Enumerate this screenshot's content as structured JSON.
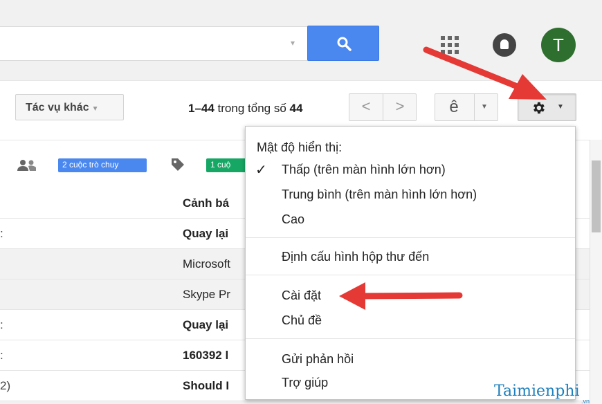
{
  "header": {
    "search_placeholder": "",
    "avatar_letter": "T"
  },
  "toolbar": {
    "more_actions_label": "Tác vụ khác",
    "range_bold_1": "1–44",
    "range_middle": " trong tổng số ",
    "range_bold_2": "44",
    "prev_label": "<",
    "next_label": ">",
    "language_label": "ê"
  },
  "tabs": {
    "social_badge": "2 cuộc trò chuy",
    "promo_badge": "1 cuộ"
  },
  "rows": [
    {
      "left": "",
      "subject": "Cảnh bá",
      "unread": true
    },
    {
      "left": ":",
      "subject": "Quay lại",
      "unread": true
    },
    {
      "left": "",
      "subject": "Microsoft",
      "unread": false
    },
    {
      "left": "",
      "subject": "Skype Pr",
      "unread": false
    },
    {
      "left": ":",
      "subject": "Quay lại",
      "unread": true
    },
    {
      "left": ":",
      "subject": "160392 l",
      "unread": true
    },
    {
      "left": "2)",
      "subject": "Should I",
      "unread": true
    }
  ],
  "settings_menu": {
    "density_heading": "Mật độ hiển thị:",
    "density_low": "Thấp (trên màn hình lớn hơn)",
    "density_medium": "Trung bình (trên màn hình lớn hơn)",
    "density_high": "Cao",
    "configure_inbox": "Định cấu hình hộp thư đến",
    "settings": "Cài đặt",
    "themes": "Chủ đề",
    "send_feedback": "Gửi phản hồi",
    "help": "Trợ giúp"
  },
  "watermark": {
    "brand": "Taimienphi",
    "suffix": ".vn"
  },
  "colors": {
    "search_button": "#4a87ee",
    "avatar": "#2e6e2e",
    "annotation_arrow": "#e53935",
    "social_badge": "#4a87ee",
    "promo_badge": "#16a765"
  }
}
